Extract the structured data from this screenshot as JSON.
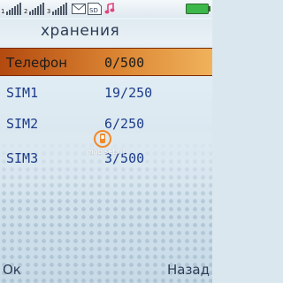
{
  "status_bar": {
    "signals": [
      {
        "icon": "signal-icon",
        "label": "1"
      },
      {
        "icon": "signal-icon",
        "label": "2"
      },
      {
        "icon": "signal-icon",
        "label": "3"
      }
    ],
    "message_icon": "envelope-icon",
    "sd_icon": "sd-card-icon",
    "sd_label": "SD",
    "music_icon": "music-note-icon",
    "battery_icon": "battery-icon",
    "battery_color": "#3cb84a"
  },
  "header": {
    "title": "хранения"
  },
  "rows": [
    {
      "name": "Телефон",
      "value": "0/500",
      "selected": true
    },
    {
      "name": "SIM1",
      "value": "19/250",
      "selected": false
    },
    {
      "name": "SIM2",
      "value": "6/250",
      "selected": false
    },
    {
      "name": "SIM3",
      "value": "3/500",
      "selected": false
    }
  ],
  "watermark": "mobiset.ru",
  "softkeys": {
    "left": "Ок",
    "right": "Назад"
  },
  "colors": {
    "accent": "#de8a36",
    "text": "#1c3c8a",
    "title": "#2d3d56"
  }
}
